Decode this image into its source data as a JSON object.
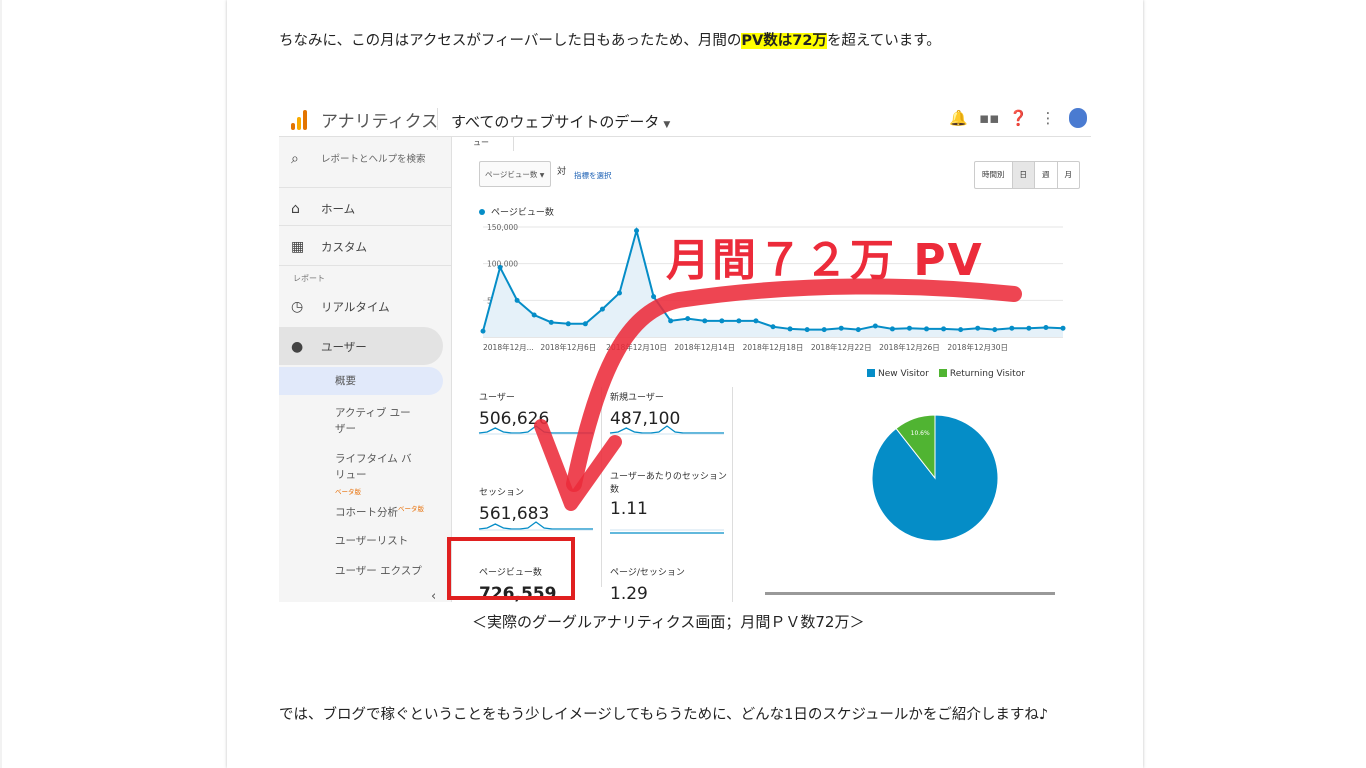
{
  "article": {
    "para1_before": "ちなみに、この月はアクセスがフィーバーした日もあったため、月間の",
    "para1_highlight": "PV数は72万",
    "para1_after": "を超えています。",
    "caption": "＜実際のグーグルアナリティクス画面；月間ＰＶ数72万＞",
    "para2": "では、ブログで稼ぐということをもう少しイメージしてもらうために、どんな1日のスケジュールかをご紹介しますね♪"
  },
  "analytics": {
    "app_title": "アナリティクス",
    "property": "すべてのウェブサイトのデータ",
    "tab_label": "ュー",
    "colors": {
      "accent": "#058dc7",
      "returning": "#50b432",
      "annotation": "#ec2b3a"
    },
    "top_icons": [
      "bell-icon",
      "apps-icon",
      "help-icon",
      "more-icon",
      "avatar"
    ],
    "sidebar": {
      "search": "レポートとヘルプを検索",
      "home": "ホーム",
      "custom": "カスタム",
      "section": "レポート",
      "realtime": "リアルタイム",
      "users": "ユーザー",
      "sub": {
        "overview": "概要",
        "active_users": "アクティブ ユーザー",
        "lifetime_value": "ライフタイム バリュー",
        "beta": "ベータ版",
        "cohort": "コホート分析",
        "user_list": "ユーザーリスト",
        "user_explorer": "ユーザー エクスプ"
      }
    },
    "controls": {
      "metric_dropdown": "ページビュー数",
      "vs": "対",
      "select_metric": "指標を選択",
      "ranges": [
        "時間別",
        "日",
        "週",
        "月"
      ],
      "range_selected": "日"
    },
    "metrics": [
      {
        "label": "ユーザー",
        "value": "506,626"
      },
      {
        "label": "新規ユーザー",
        "value": "487,100"
      },
      {
        "label": "セッション",
        "value": "561,683"
      },
      {
        "label": "ユーザーあたりのセッション数",
        "value": "1.11"
      },
      {
        "label": "ページビュー数",
        "value": "726,559"
      },
      {
        "label": "ページ/セッション",
        "value": "1.29"
      }
    ],
    "pie": {
      "legend": [
        "New Visitor",
        "Returning Visitor"
      ],
      "values": [
        89.4,
        10.6
      ],
      "labels": [
        "89.4%",
        "10.6%"
      ]
    },
    "annotation_text": "月間７２万 PV"
  },
  "chart_data": {
    "type": "line",
    "title": "",
    "series": [
      {
        "name": "ページビュー数",
        "values": [
          8000,
          95000,
          50000,
          30000,
          20000,
          18000,
          18000,
          38000,
          60000,
          145000,
          55000,
          22000,
          25000,
          22000,
          22000,
          22000,
          22000,
          14000,
          11000,
          10000,
          10000,
          12000,
          10000,
          15000,
          11000,
          12000,
          11000,
          11000,
          10000,
          12000,
          10000,
          12000,
          12000,
          13000,
          12000
        ]
      }
    ],
    "y_ticks": [
      "150,000",
      "100,000",
      "50,000"
    ],
    "ylim": [
      0,
      150000
    ],
    "x_ticks": [
      "2018年12月...",
      "2018年12月6日",
      "2018年12月10日",
      "2018年12月14日",
      "2018年12月18日",
      "2018年12月22日",
      "2018年12月26日",
      "2018年12月30日"
    ],
    "xlabel": "",
    "ylabel": ""
  }
}
